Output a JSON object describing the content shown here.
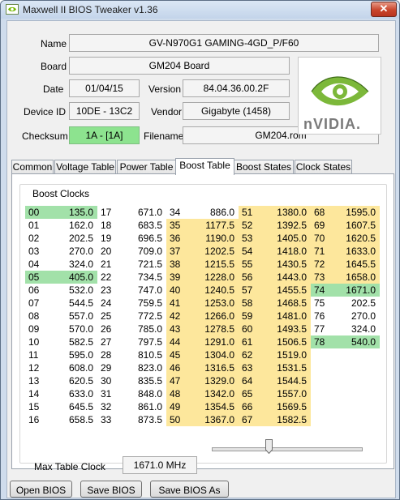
{
  "window": {
    "title": "Maxwell II BIOS Tweaker v1.36",
    "close_label": "✕"
  },
  "info": {
    "name_label": "Name",
    "name_value": "GV-N970G1 GAMING-4GD_P/F60",
    "board_label": "Board",
    "board_value": "GM204 Board",
    "date_label": "Date",
    "date_value": "01/04/15",
    "version_label": "Version",
    "version_value": "84.04.36.00.2F",
    "device_label": "Device ID",
    "device_value": "10DE - 13C2",
    "vendor_label": "Vendor",
    "vendor_value": "Gigabyte (1458)",
    "checksum_label": "Checksum",
    "checksum_value": "1A - [1A]",
    "filename_label": "Filename",
    "filename_value": "GM204.rom"
  },
  "logo": {
    "icon": "nvidia-eye-icon",
    "text": "nVIDIA."
  },
  "tabs": [
    "Common",
    "Voltage Table",
    "Power Table",
    "Boost Table",
    "Boost States",
    "Clock States"
  ],
  "active_tab": "Boost Table",
  "boost": {
    "group_title": "Boost Clocks",
    "colors": {
      "green": "#a2e1a9",
      "yellow": "#fde79c"
    },
    "rows": [
      [
        [
          "00",
          "135.0",
          "g"
        ],
        [
          "17",
          "671.0",
          ""
        ],
        [
          "34",
          "886.0",
          ""
        ],
        [
          "51",
          "1380.0",
          "y"
        ],
        [
          "68",
          "1595.0",
          "y"
        ]
      ],
      [
        [
          "01",
          "162.0",
          ""
        ],
        [
          "18",
          "683.5",
          ""
        ],
        [
          "35",
          "1177.5",
          "y"
        ],
        [
          "52",
          "1392.5",
          "y"
        ],
        [
          "69",
          "1607.5",
          "y"
        ]
      ],
      [
        [
          "02",
          "202.5",
          ""
        ],
        [
          "19",
          "696.5",
          ""
        ],
        [
          "36",
          "1190.0",
          "y"
        ],
        [
          "53",
          "1405.0",
          "y"
        ],
        [
          "70",
          "1620.5",
          "y"
        ]
      ],
      [
        [
          "03",
          "270.0",
          ""
        ],
        [
          "20",
          "709.0",
          ""
        ],
        [
          "37",
          "1202.5",
          "y"
        ],
        [
          "54",
          "1418.0",
          "y"
        ],
        [
          "71",
          "1633.0",
          "y"
        ]
      ],
      [
        [
          "04",
          "324.0",
          ""
        ],
        [
          "21",
          "721.5",
          ""
        ],
        [
          "38",
          "1215.5",
          "y"
        ],
        [
          "55",
          "1430.5",
          "y"
        ],
        [
          "72",
          "1645.5",
          "y"
        ]
      ],
      [
        [
          "05",
          "405.0",
          "g"
        ],
        [
          "22",
          "734.5",
          ""
        ],
        [
          "39",
          "1228.0",
          "y"
        ],
        [
          "56",
          "1443.0",
          "y"
        ],
        [
          "73",
          "1658.0",
          "y"
        ]
      ],
      [
        [
          "06",
          "532.0",
          ""
        ],
        [
          "23",
          "747.0",
          ""
        ],
        [
          "40",
          "1240.5",
          "y"
        ],
        [
          "57",
          "1455.5",
          "y"
        ],
        [
          "74",
          "1671.0",
          "g"
        ]
      ],
      [
        [
          "07",
          "544.5",
          ""
        ],
        [
          "24",
          "759.5",
          ""
        ],
        [
          "41",
          "1253.0",
          "y"
        ],
        [
          "58",
          "1468.5",
          "y"
        ],
        [
          "75",
          "202.5",
          ""
        ]
      ],
      [
        [
          "08",
          "557.0",
          ""
        ],
        [
          "25",
          "772.5",
          ""
        ],
        [
          "42",
          "1266.0",
          "y"
        ],
        [
          "59",
          "1481.0",
          "y"
        ],
        [
          "76",
          "270.0",
          ""
        ]
      ],
      [
        [
          "09",
          "570.0",
          ""
        ],
        [
          "26",
          "785.0",
          ""
        ],
        [
          "43",
          "1278.5",
          "y"
        ],
        [
          "60",
          "1493.5",
          "y"
        ],
        [
          "77",
          "324.0",
          ""
        ]
      ],
      [
        [
          "10",
          "582.5",
          ""
        ],
        [
          "27",
          "797.5",
          ""
        ],
        [
          "44",
          "1291.0",
          "y"
        ],
        [
          "61",
          "1506.5",
          "y"
        ],
        [
          "78",
          "540.0",
          "g"
        ]
      ],
      [
        [
          "11",
          "595.0",
          ""
        ],
        [
          "28",
          "810.5",
          ""
        ],
        [
          "45",
          "1304.0",
          "y"
        ],
        [
          "62",
          "1519.0",
          "y"
        ],
        null
      ],
      [
        [
          "12",
          "608.0",
          ""
        ],
        [
          "29",
          "823.0",
          ""
        ],
        [
          "46",
          "1316.5",
          "y"
        ],
        [
          "63",
          "1531.5",
          "y"
        ],
        null
      ],
      [
        [
          "13",
          "620.5",
          ""
        ],
        [
          "30",
          "835.5",
          ""
        ],
        [
          "47",
          "1329.0",
          "y"
        ],
        [
          "64",
          "1544.5",
          "y"
        ],
        null
      ],
      [
        [
          "14",
          "633.0",
          ""
        ],
        [
          "31",
          "848.0",
          ""
        ],
        [
          "48",
          "1342.0",
          "y"
        ],
        [
          "65",
          "1557.0",
          "y"
        ],
        null
      ],
      [
        [
          "15",
          "645.5",
          ""
        ],
        [
          "32",
          "861.0",
          ""
        ],
        [
          "49",
          "1354.5",
          "y"
        ],
        [
          "66",
          "1569.5",
          "y"
        ],
        null
      ],
      [
        [
          "16",
          "658.5",
          ""
        ],
        [
          "33",
          "873.5",
          ""
        ],
        [
          "50",
          "1367.0",
          "y"
        ],
        [
          "67",
          "1582.5",
          "y"
        ],
        null
      ]
    ],
    "max_label": "Max Table Clock",
    "max_value": "1671.0 MHz"
  },
  "buttons": {
    "open": "Open BIOS",
    "save": "Save BIOS",
    "save_as": "Save BIOS As"
  }
}
